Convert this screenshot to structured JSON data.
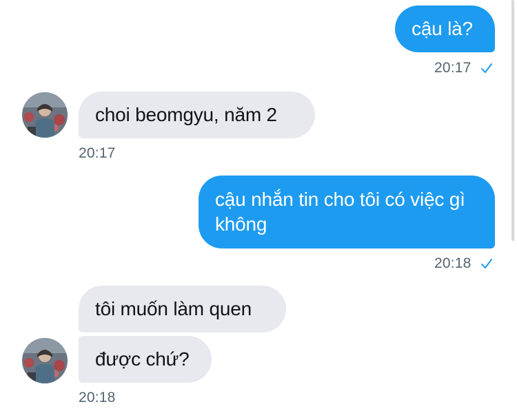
{
  "messages": [
    {
      "text": "cậu là?",
      "time": "20:17"
    },
    {
      "text": "choi beomgyu, năm 2",
      "time": "20:17"
    },
    {
      "text": "cậu nhắn tin cho tôi có việc gì không",
      "time": "20:18"
    },
    {
      "text": "tôi muốn làm quen"
    },
    {
      "text": "được chứ?",
      "time": "20:18"
    }
  ],
  "icons": {
    "read": "checkmark-icon",
    "avatar": "profile-avatar"
  },
  "colors": {
    "outgoing": "#1d9bf0",
    "incoming": "#e7e9ef",
    "timestamp": "#536471"
  }
}
